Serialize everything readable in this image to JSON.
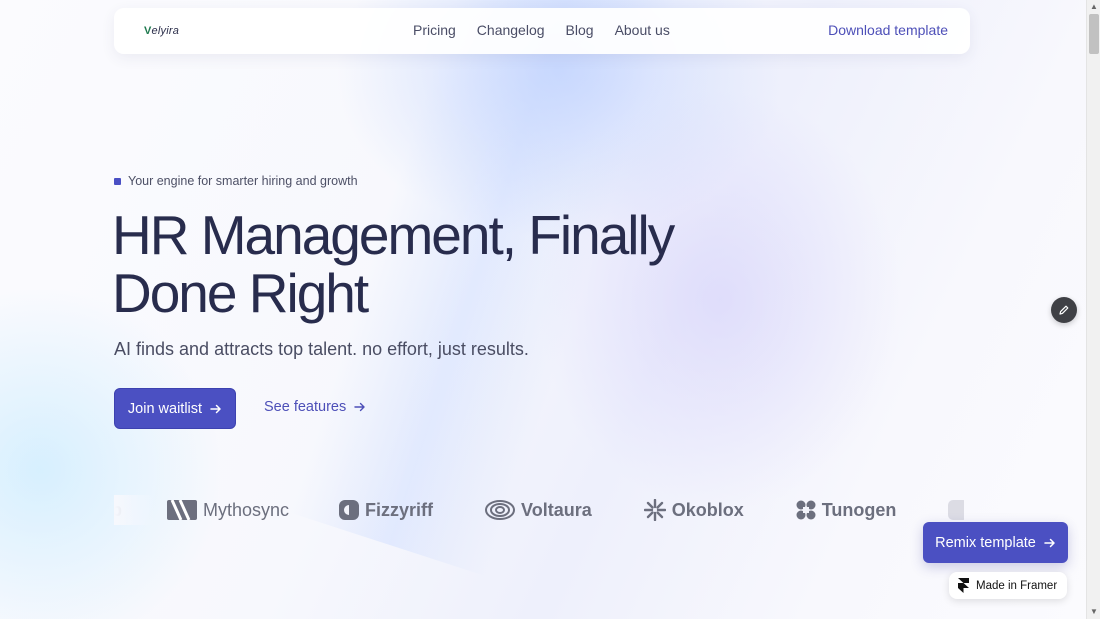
{
  "navbar": {
    "logo_initial": "V",
    "logo_rest": "elyira",
    "links": [
      "Pricing",
      "Changelog",
      "Blog",
      "About us"
    ],
    "download_label": "Download template"
  },
  "hero": {
    "tagline": "Your engine for smarter hiring and growth",
    "headline": "HR Management, Finally Done Right",
    "subhead": "AI finds and attracts top talent. no effort, just results.",
    "primary_cta": "Join waitlist",
    "secondary_cta": "See features"
  },
  "logos": {
    "items": [
      {
        "name": "op",
        "icon": "partial-logo-icon"
      },
      {
        "name": "Mythosync",
        "icon": "mythosync-icon"
      },
      {
        "name": "Fizzyriff",
        "icon": "fizzyriff-icon"
      },
      {
        "name": "Voltaura",
        "icon": "voltaura-icon"
      },
      {
        "name": "Okoblox",
        "icon": "okoblox-icon"
      },
      {
        "name": "Tunogen",
        "icon": "tunogen-icon"
      }
    ]
  },
  "floating": {
    "remix_label": "Remix template",
    "framer_badge": "Made in Framer"
  },
  "colors": {
    "accent": "#4b50c2",
    "heading": "#282c4d",
    "logo_gray": "#6c6f7e"
  }
}
